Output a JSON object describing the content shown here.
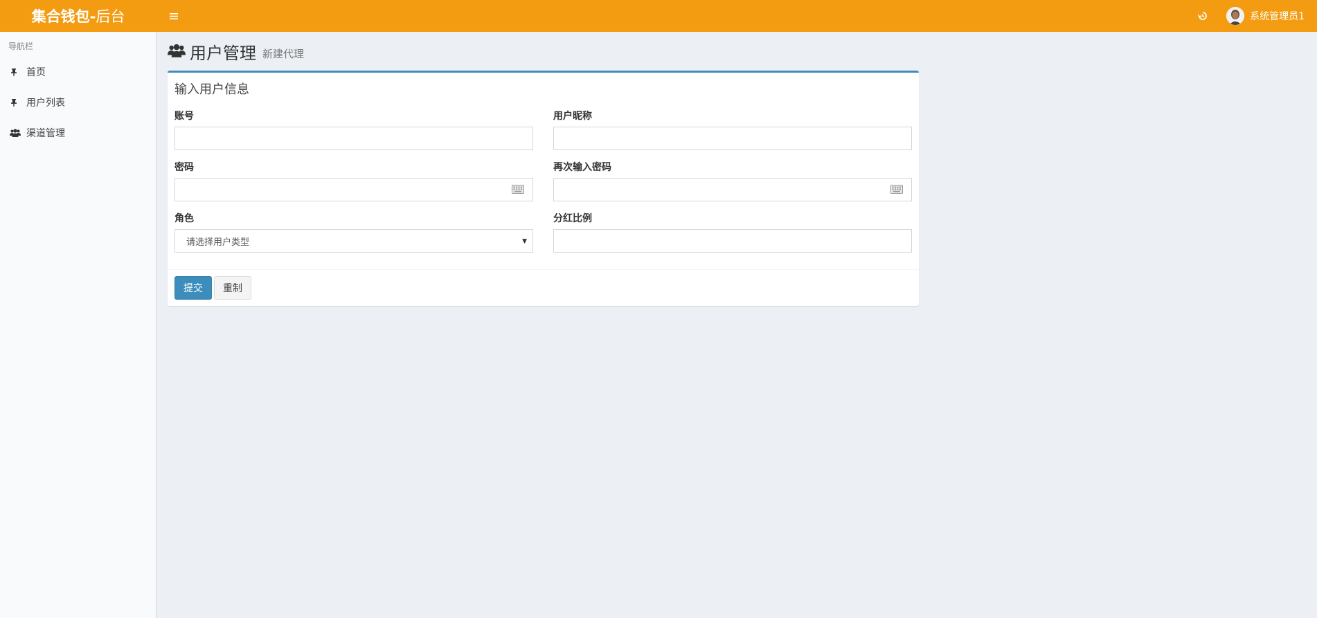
{
  "header": {
    "logo_bold": "集合钱包-",
    "logo_light": "后台",
    "user_name": "系统管理员1"
  },
  "sidebar": {
    "heading": "导航栏",
    "items": [
      {
        "label": "首页",
        "icon": "thumbtack-icon"
      },
      {
        "label": "用户列表",
        "icon": "thumbtack-icon"
      },
      {
        "label": "渠道管理",
        "icon": "users-icon"
      }
    ]
  },
  "page": {
    "title": "用户管理",
    "subtitle": "新建代理"
  },
  "form": {
    "box_title": "输入用户信息",
    "account_label": "账号",
    "nickname_label": "用户昵称",
    "password_label": "密码",
    "password_confirm_label": "再次输入密码",
    "role_label": "角色",
    "role_selected": "请选择用户类型",
    "share_ratio_label": "分红比例",
    "submit_label": "提交",
    "reset_label": "重制"
  },
  "colors": {
    "header_bg": "#f39c12",
    "primary": "#3c8dbc",
    "content_bg": "#ecf0f5",
    "sidebar_bg": "#f9fafc"
  }
}
